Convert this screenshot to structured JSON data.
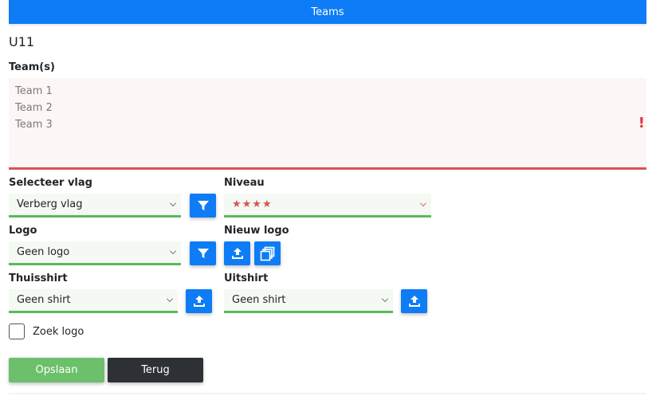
{
  "header": {
    "title": "Teams"
  },
  "form": {
    "group_name": "U11",
    "teams_label": "Team(s)",
    "teams": [
      "Team 1",
      "Team 2",
      "Team 3"
    ],
    "teams_error_mark": "!",
    "flag_label": "Selecteer vlag",
    "flag_value": "Verberg vlag",
    "level_label": "Niveau",
    "level_value": "★★★★",
    "logo_label": "Logo",
    "logo_value": "Geen logo",
    "new_logo_label": "Nieuw logo",
    "home_shirt_label": "Thuisshirt",
    "home_shirt_value": "Geen shirt",
    "away_shirt_label": "Uitshirt",
    "away_shirt_value": "Geen shirt",
    "search_logo_label": "Zoek logo",
    "search_logo_checked": false,
    "save_label": "Opslaan",
    "back_label": "Terug"
  },
  "colors": {
    "primary": "#0d7cf6",
    "valid": "#5cb85c",
    "invalid": "#d9534f",
    "save": "#6cc06c",
    "back": "#2d3035"
  },
  "icons": [
    "filter-icon",
    "upload-icon",
    "copy-icon",
    "chevron-down-icon"
  ]
}
